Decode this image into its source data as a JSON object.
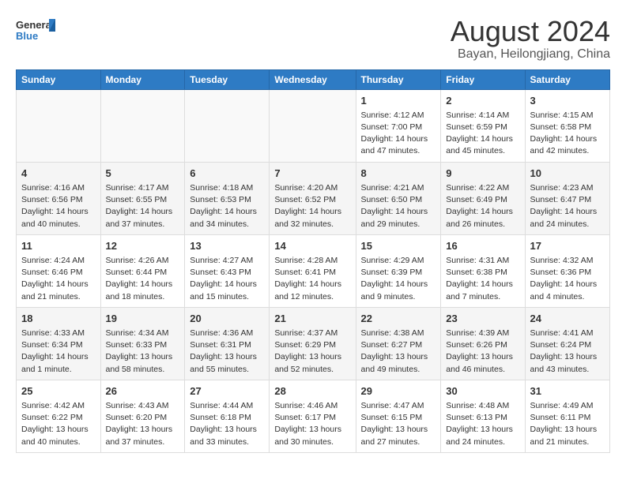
{
  "header": {
    "logo_line1": "General",
    "logo_line2": "Blue",
    "month": "August 2024",
    "location": "Bayan, Heilongjiang, China"
  },
  "weekdays": [
    "Sunday",
    "Monday",
    "Tuesday",
    "Wednesday",
    "Thursday",
    "Friday",
    "Saturday"
  ],
  "weeks": [
    [
      {
        "day": "",
        "info": ""
      },
      {
        "day": "",
        "info": ""
      },
      {
        "day": "",
        "info": ""
      },
      {
        "day": "",
        "info": ""
      },
      {
        "day": "1",
        "info": "Sunrise: 4:12 AM\nSunset: 7:00 PM\nDaylight: 14 hours\nand 47 minutes."
      },
      {
        "day": "2",
        "info": "Sunrise: 4:14 AM\nSunset: 6:59 PM\nDaylight: 14 hours\nand 45 minutes."
      },
      {
        "day": "3",
        "info": "Sunrise: 4:15 AM\nSunset: 6:58 PM\nDaylight: 14 hours\nand 42 minutes."
      }
    ],
    [
      {
        "day": "4",
        "info": "Sunrise: 4:16 AM\nSunset: 6:56 PM\nDaylight: 14 hours\nand 40 minutes."
      },
      {
        "day": "5",
        "info": "Sunrise: 4:17 AM\nSunset: 6:55 PM\nDaylight: 14 hours\nand 37 minutes."
      },
      {
        "day": "6",
        "info": "Sunrise: 4:18 AM\nSunset: 6:53 PM\nDaylight: 14 hours\nand 34 minutes."
      },
      {
        "day": "7",
        "info": "Sunrise: 4:20 AM\nSunset: 6:52 PM\nDaylight: 14 hours\nand 32 minutes."
      },
      {
        "day": "8",
        "info": "Sunrise: 4:21 AM\nSunset: 6:50 PM\nDaylight: 14 hours\nand 29 minutes."
      },
      {
        "day": "9",
        "info": "Sunrise: 4:22 AM\nSunset: 6:49 PM\nDaylight: 14 hours\nand 26 minutes."
      },
      {
        "day": "10",
        "info": "Sunrise: 4:23 AM\nSunset: 6:47 PM\nDaylight: 14 hours\nand 24 minutes."
      }
    ],
    [
      {
        "day": "11",
        "info": "Sunrise: 4:24 AM\nSunset: 6:46 PM\nDaylight: 14 hours\nand 21 minutes."
      },
      {
        "day": "12",
        "info": "Sunrise: 4:26 AM\nSunset: 6:44 PM\nDaylight: 14 hours\nand 18 minutes."
      },
      {
        "day": "13",
        "info": "Sunrise: 4:27 AM\nSunset: 6:43 PM\nDaylight: 14 hours\nand 15 minutes."
      },
      {
        "day": "14",
        "info": "Sunrise: 4:28 AM\nSunset: 6:41 PM\nDaylight: 14 hours\nand 12 minutes."
      },
      {
        "day": "15",
        "info": "Sunrise: 4:29 AM\nSunset: 6:39 PM\nDaylight: 14 hours\nand 9 minutes."
      },
      {
        "day": "16",
        "info": "Sunrise: 4:31 AM\nSunset: 6:38 PM\nDaylight: 14 hours\nand 7 minutes."
      },
      {
        "day": "17",
        "info": "Sunrise: 4:32 AM\nSunset: 6:36 PM\nDaylight: 14 hours\nand 4 minutes."
      }
    ],
    [
      {
        "day": "18",
        "info": "Sunrise: 4:33 AM\nSunset: 6:34 PM\nDaylight: 14 hours\nand 1 minute."
      },
      {
        "day": "19",
        "info": "Sunrise: 4:34 AM\nSunset: 6:33 PM\nDaylight: 13 hours\nand 58 minutes."
      },
      {
        "day": "20",
        "info": "Sunrise: 4:36 AM\nSunset: 6:31 PM\nDaylight: 13 hours\nand 55 minutes."
      },
      {
        "day": "21",
        "info": "Sunrise: 4:37 AM\nSunset: 6:29 PM\nDaylight: 13 hours\nand 52 minutes."
      },
      {
        "day": "22",
        "info": "Sunrise: 4:38 AM\nSunset: 6:27 PM\nDaylight: 13 hours\nand 49 minutes."
      },
      {
        "day": "23",
        "info": "Sunrise: 4:39 AM\nSunset: 6:26 PM\nDaylight: 13 hours\nand 46 minutes."
      },
      {
        "day": "24",
        "info": "Sunrise: 4:41 AM\nSunset: 6:24 PM\nDaylight: 13 hours\nand 43 minutes."
      }
    ],
    [
      {
        "day": "25",
        "info": "Sunrise: 4:42 AM\nSunset: 6:22 PM\nDaylight: 13 hours\nand 40 minutes."
      },
      {
        "day": "26",
        "info": "Sunrise: 4:43 AM\nSunset: 6:20 PM\nDaylight: 13 hours\nand 37 minutes."
      },
      {
        "day": "27",
        "info": "Sunrise: 4:44 AM\nSunset: 6:18 PM\nDaylight: 13 hours\nand 33 minutes."
      },
      {
        "day": "28",
        "info": "Sunrise: 4:46 AM\nSunset: 6:17 PM\nDaylight: 13 hours\nand 30 minutes."
      },
      {
        "day": "29",
        "info": "Sunrise: 4:47 AM\nSunset: 6:15 PM\nDaylight: 13 hours\nand 27 minutes."
      },
      {
        "day": "30",
        "info": "Sunrise: 4:48 AM\nSunset: 6:13 PM\nDaylight: 13 hours\nand 24 minutes."
      },
      {
        "day": "31",
        "info": "Sunrise: 4:49 AM\nSunset: 6:11 PM\nDaylight: 13 hours\nand 21 minutes."
      }
    ]
  ]
}
